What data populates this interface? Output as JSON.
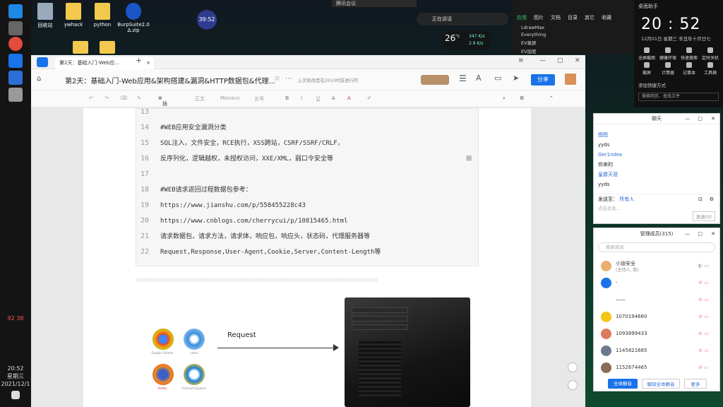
{
  "desktop": {
    "icons": [
      {
        "label": "回收站",
        "icon": "recycle-bin-icon"
      },
      {
        "label": "ywhack",
        "icon": "folder-icon"
      },
      {
        "label": "python",
        "icon": "folder-icon"
      },
      {
        "label": "BurpSuite2.0 Δ.zip",
        "icon": "zip-icon"
      }
    ],
    "time_bubble": "39:52",
    "topbar_text": "腾讯会议",
    "recording_text": "正在讲话",
    "weather_temp": "26",
    "weather_unit": "°c",
    "net_up": "347 K/s",
    "net_down": "2.9 K/s"
  },
  "taskbar": {
    "time": "20:52",
    "weekday": "星期三",
    "date": "2021/12/1",
    "tray": "92 38"
  },
  "launcher": {
    "tabs": [
      "应用",
      "图片",
      "文档",
      "目录",
      "其它",
      "收藏"
    ],
    "active_tab": "应用",
    "items": [
      "LdrawMax",
      "Everything",
      "EV录屏",
      "EV加密"
    ]
  },
  "clock_panel": {
    "header": "桌面助手",
    "time": "20 : 52",
    "date": "12月01日  星期三  辛丑年十月廿七",
    "shortcuts": [
      "全屏截图",
      "健康环保",
      "快速搜索",
      "定时关机",
      "截屏",
      "计算器",
      "记事本",
      "工具箱"
    ],
    "footer": "添加快捷方式",
    "search_placeholder": "搜索网页、查找文件"
  },
  "editor": {
    "tab_title": "第2天：基础入门-Web应...",
    "doc_title": "第2天：基础入门-Web应用&架构搭建&漏洞&HTTP数据包&代理...",
    "save_note": "上次修改是在20小时前进行的",
    "share_label": "分享",
    "toolbar": {
      "insert_label": "插入",
      "style_label": "正文",
      "font_label": "Monaco",
      "size_label": "五号"
    },
    "code_lines": [
      {
        "n": "13",
        "t": ""
      },
      {
        "n": "14",
        "t": "#WEB应用安全漏洞分类"
      },
      {
        "n": "15",
        "t": "SQL注入，文件安全，RCE执行，XSS跨站，CSRF/SSRF/CRLF，"
      },
      {
        "n": "16",
        "t": "反序列化，逻辑越权，未授权访问，XXE/XML，弱口令安全等"
      },
      {
        "n": "17",
        "t": ""
      },
      {
        "n": "18",
        "t": "#WEB请求返回过程数据包参考："
      },
      {
        "n": "19",
        "t": "https://www.jianshu.com/p/558455228c43"
      },
      {
        "n": "20",
        "t": "https://www.cnblogs.com/cherrycui/p/10815465.html"
      },
      {
        "n": "21",
        "t": "请求数据包，请求方法，请求体，响应包，响应头，状态码，代理服务器等"
      },
      {
        "n": "22",
        "t": "Request,Response,User-Agent,Cookie,Server,Content-Length等"
      }
    ],
    "diagram": {
      "request_label": "Request",
      "browsers": [
        "Google Chrome",
        "safari",
        "Firefox",
        "Internet Explorer"
      ]
    }
  },
  "chat": {
    "title": "聊天",
    "messages": [
      {
        "text": "图图",
        "link": true
      },
      {
        "text": "yyds",
        "link": false
      },
      {
        "text": "Ger1ndex",
        "link": true
      },
      {
        "text": "你来的",
        "link": false
      },
      {
        "text": "皇爵天涯",
        "link": true
      },
      {
        "text": "yyds",
        "link": false
      }
    ],
    "send_to_label": "发送至：",
    "send_to_value": "所有人",
    "input_placeholder": "点击此处…",
    "send_button": "发送(S)"
  },
  "members": {
    "title": "管理成员(315)",
    "search_placeholder": "搜索成员",
    "rows": [
      {
        "name": "小迪安全",
        "sub": "(主持人, 我)",
        "color": "#e8b070"
      },
      {
        "name": "-",
        "sub": "",
        "color": "#1a73e8"
      },
      {
        "name": "——",
        "sub": "",
        "color": "#ffffff"
      },
      {
        "name": "1070194660",
        "sub": "",
        "color": "#f5c518"
      },
      {
        "name": "1093899433",
        "sub": "",
        "color": "#e07a5f"
      },
      {
        "name": "1145821685",
        "sub": "",
        "color": "#6b7a8f"
      },
      {
        "name": "1152674465",
        "sub": "",
        "color": "#8a6b5a"
      }
    ],
    "mute_all": "全体静音",
    "unmute_all": "解除全体静音",
    "more": "更多"
  }
}
